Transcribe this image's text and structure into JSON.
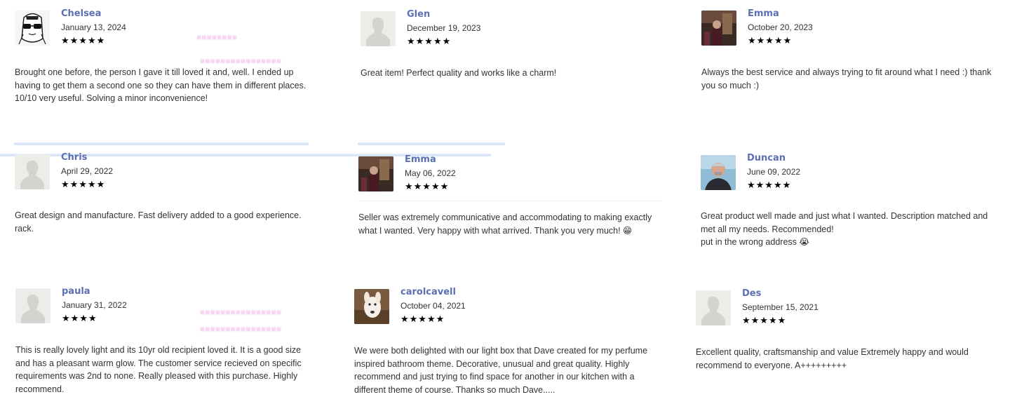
{
  "reviews": [
    {
      "name": "Chelsea",
      "date": "January 13, 2024",
      "stars": "★★★★★",
      "rating": 5,
      "avatar": "cartoon-avatar-image",
      "text": "Brought one before, the person I gave it till loved it and, well. I ended up having to get them a second one so they can have them in different places. 10/10 very useful. Solving a minor inconvenience!"
    },
    {
      "name": "Glen",
      "date": "December 19, 2023",
      "stars": "★★★★★",
      "rating": 5,
      "avatar": "default-user-icon",
      "text": "Great item! Perfect quality and works like a charm!"
    },
    {
      "name": "Emma",
      "date": "October 20, 2023",
      "stars": "★★★★★",
      "rating": 5,
      "avatar": "photo-avatar-image",
      "text": "Always the best service and always trying to fit around what I need :) thank you so much :)"
    },
    {
      "name": "Chris",
      "date": "April 29, 2022",
      "stars": "★★★★★",
      "rating": 5,
      "avatar": "default-user-icon",
      "text": "Great design and manufacture. Fast delivery added to a good experience.\nrack."
    },
    {
      "name": "Emma",
      "date": "May 06, 2022",
      "stars": "★★★★★",
      "rating": 5,
      "avatar": "photo-avatar-image",
      "text": "Seller was extremely communicative and accommodating to making exactly what I wanted. Very happy with what arrived. Thank you very much! 😁"
    },
    {
      "name": "Duncan",
      "date": "June 09, 2022",
      "stars": "★★★★★",
      "rating": 5,
      "avatar": "photo-avatar-image",
      "text": "Great product well made and just what I wanted. Description matched and met all my needs. Recommended!\nput in the wrong address 😭"
    },
    {
      "name": "paula",
      "date": "January 31, 2022",
      "stars": "★★★★",
      "rating": 4,
      "avatar": "default-user-icon",
      "text": "This is really lovely light and its 10yr old recipient loved it. It is a good size and has a pleasant warm glow. The customer service recieved on specific requirements was 2nd to none. Really pleased with this purchase. Highly recommend."
    },
    {
      "name": "carolcavell",
      "date": "October 04, 2021",
      "stars": "★★★★★",
      "rating": 5,
      "avatar": "dog-photo-image",
      "text": "We were both delighted with our light box that Dave created for my perfume inspired bathroom theme. Decorative, unusual and great quality. Highly recommend and just trying to find space for another in our kitchen with a different theme of course. Thanks so much Dave....."
    },
    {
      "name": "Des",
      "date": "September 15, 2021",
      "stars": "★★★★★",
      "rating": 5,
      "avatar": "default-user-icon",
      "text": "Excellent quality, craftsmanship and value Extremely happy and would recommend to everyone. A+++++++++"
    }
  ],
  "colors": {
    "name": "#5b6fb4",
    "text": "#333333",
    "star": "#000000"
  }
}
